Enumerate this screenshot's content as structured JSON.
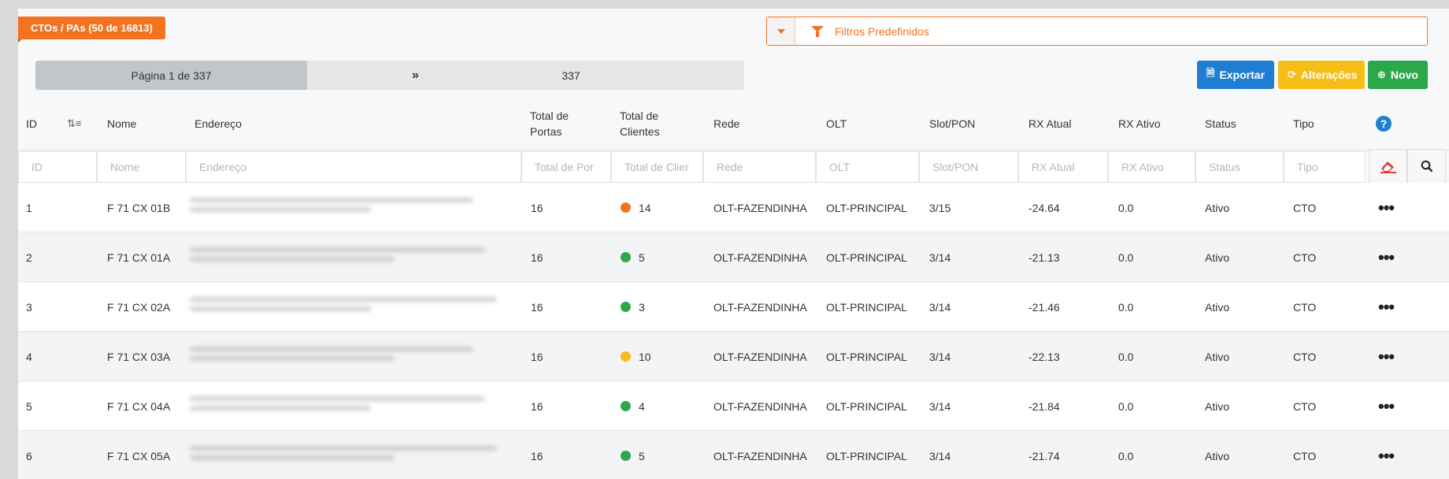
{
  "title": "CTOs / PAs (50 de 16813)",
  "filter": {
    "label": "Filtros Predefinidos",
    "color": "#f47321"
  },
  "pager": {
    "current": "Página 1 de 337",
    "next": "»",
    "last": "337"
  },
  "actions": {
    "export": "Exportar",
    "changes": "Alterações",
    "new": "Novo"
  },
  "columns": [
    "ID",
    "Nome",
    "Endereço",
    "Total de Portas",
    "Total de Clientes",
    "Rede",
    "OLT",
    "Slot/PON",
    "RX Atual",
    "RX Ativo",
    "Status",
    "Tipo"
  ],
  "column_lines": {
    "total_portas": [
      "Total de",
      "Portas"
    ],
    "total_clientes": [
      "Total de",
      "Clientes"
    ]
  },
  "filters": [
    "ID",
    "Nome",
    "Endereço",
    "Total de Por",
    "Total de Clier",
    "Rede",
    "OLT",
    "Slot/PON",
    "RX Atual",
    "RX Ativo",
    "Status",
    "Tipo"
  ],
  "status_colors": {
    "orange": "#f47321",
    "green": "#2ba84a",
    "yellow": "#f6bd16"
  },
  "rows": [
    {
      "id": "1",
      "nome": "F 71 CX 01B",
      "portas": "16",
      "clientes": "14",
      "dot": "#f47321",
      "rede": "OLT-FAZENDINHA",
      "olt": "OLT-PRINCIPAL",
      "slot": "3/15",
      "rx_atual": "-24.64",
      "rx_ativo": "0.0",
      "status": "Ativo",
      "tipo": "CTO"
    },
    {
      "id": "2",
      "nome": "F 71 CX 01A",
      "portas": "16",
      "clientes": "5",
      "dot": "#2ba84a",
      "rede": "OLT-FAZENDINHA",
      "olt": "OLT-PRINCIPAL",
      "slot": "3/14",
      "rx_atual": "-21.13",
      "rx_ativo": "0.0",
      "status": "Ativo",
      "tipo": "CTO"
    },
    {
      "id": "3",
      "nome": "F 71 CX 02A",
      "portas": "16",
      "clientes": "3",
      "dot": "#2ba84a",
      "rede": "OLT-FAZENDINHA",
      "olt": "OLT-PRINCIPAL",
      "slot": "3/14",
      "rx_atual": "-21.46",
      "rx_ativo": "0.0",
      "status": "Ativo",
      "tipo": "CTO"
    },
    {
      "id": "4",
      "nome": "F 71 CX 03A",
      "portas": "16",
      "clientes": "10",
      "dot": "#f6bd16",
      "rede": "OLT-FAZENDINHA",
      "olt": "OLT-PRINCIPAL",
      "slot": "3/14",
      "rx_atual": "-22.13",
      "rx_ativo": "0.0",
      "status": "Ativo",
      "tipo": "CTO"
    },
    {
      "id": "5",
      "nome": "F 71 CX 04A",
      "portas": "16",
      "clientes": "4",
      "dot": "#2ba84a",
      "rede": "OLT-FAZENDINHA",
      "olt": "OLT-PRINCIPAL",
      "slot": "3/14",
      "rx_atual": "-21.84",
      "rx_ativo": "0.0",
      "status": "Ativo",
      "tipo": "CTO"
    },
    {
      "id": "6",
      "nome": "F 71 CX 05A",
      "portas": "16",
      "clientes": "5",
      "dot": "#2ba84a",
      "rede": "OLT-FAZENDINHA",
      "olt": "OLT-PRINCIPAL",
      "slot": "3/14",
      "rx_atual": "-21.74",
      "rx_ativo": "0.0",
      "status": "Ativo",
      "tipo": "CTO"
    }
  ]
}
